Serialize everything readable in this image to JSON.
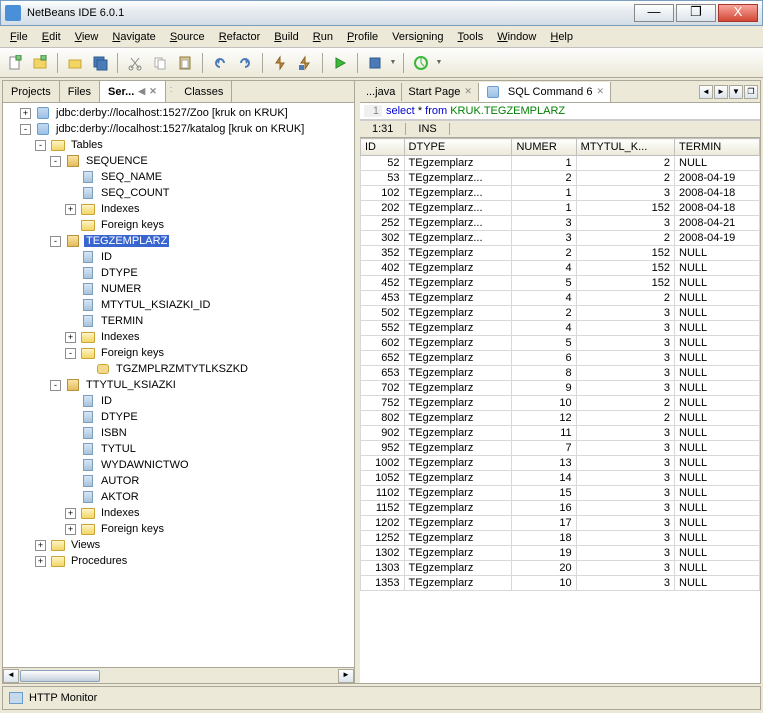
{
  "window": {
    "title": "NetBeans IDE 6.0.1"
  },
  "menu": [
    "File",
    "Edit",
    "View",
    "Navigate",
    "Source",
    "Refactor",
    "Build",
    "Run",
    "Profile",
    "Versioning",
    "Tools",
    "Window",
    "Help"
  ],
  "left_tabs": [
    {
      "label": "Projects",
      "active": false
    },
    {
      "label": "Files",
      "active": false
    },
    {
      "label": "Ser...",
      "active": true
    },
    {
      "label": "Classes",
      "active": false
    }
  ],
  "tree": {
    "conn1": "jdbc:derby://localhost:1527/Zoo [kruk on KRUK]",
    "conn2": "jdbc:derby://localhost:1527/katalog [kruk on KRUK]",
    "tables": "Tables",
    "sequence": {
      "name": "SEQUENCE",
      "cols": [
        "SEQ_NAME",
        "SEQ_COUNT"
      ],
      "indexes": "Indexes",
      "fk": "Foreign keys"
    },
    "tegz": {
      "name": "TEGZEMPLARZ",
      "cols": [
        "ID",
        "DTYPE",
        "NUMER",
        "MTYTUL_KSIAZKI_ID",
        "TERMIN"
      ],
      "indexes": "Indexes",
      "fk": "Foreign keys",
      "fk1": "TGZMPLRZMTYTLKSZKD"
    },
    "ttytul": {
      "name": "TTYTUL_KSIAZKI",
      "cols": [
        "ID",
        "DTYPE",
        "ISBN",
        "TYTUL",
        "WYDAWNICTWO",
        "AUTOR",
        "AKTOR"
      ],
      "indexes": "Indexes",
      "fk": "Foreign keys"
    },
    "views": "Views",
    "procedures": "Procedures"
  },
  "editor_tabs": [
    {
      "label": "...java",
      "active": false
    },
    {
      "label": "Start Page",
      "active": false
    },
    {
      "label": "SQL Command 6",
      "active": true
    }
  ],
  "sql": {
    "line": "1",
    "select": "select",
    "star": "*",
    "from": "from",
    "schema": "KRUK.TEGZEMPLARZ"
  },
  "status": {
    "pos": "1:31",
    "mode": "INS"
  },
  "columns": [
    "ID",
    "DTYPE",
    "NUMER",
    "MTYTUL_K...",
    "TERMIN"
  ],
  "rows": [
    [
      52,
      "TEgzemplarz",
      1,
      2,
      "NULL"
    ],
    [
      53,
      "TEgzemplarz...",
      2,
      2,
      "2008-04-19"
    ],
    [
      102,
      "TEgzemplarz...",
      1,
      3,
      "2008-04-18"
    ],
    [
      202,
      "TEgzemplarz...",
      1,
      152,
      "2008-04-18"
    ],
    [
      252,
      "TEgzemplarz...",
      3,
      3,
      "2008-04-21"
    ],
    [
      302,
      "TEgzemplarz...",
      3,
      2,
      "2008-04-19"
    ],
    [
      352,
      "TEgzemplarz",
      2,
      152,
      "NULL"
    ],
    [
      402,
      "TEgzemplarz",
      4,
      152,
      "NULL"
    ],
    [
      452,
      "TEgzemplarz",
      5,
      152,
      "NULL"
    ],
    [
      453,
      "TEgzemplarz",
      4,
      2,
      "NULL"
    ],
    [
      502,
      "TEgzemplarz",
      2,
      3,
      "NULL"
    ],
    [
      552,
      "TEgzemplarz",
      4,
      3,
      "NULL"
    ],
    [
      602,
      "TEgzemplarz",
      5,
      3,
      "NULL"
    ],
    [
      652,
      "TEgzemplarz",
      6,
      3,
      "NULL"
    ],
    [
      653,
      "TEgzemplarz",
      8,
      3,
      "NULL"
    ],
    [
      702,
      "TEgzemplarz",
      9,
      3,
      "NULL"
    ],
    [
      752,
      "TEgzemplarz",
      10,
      2,
      "NULL"
    ],
    [
      802,
      "TEgzemplarz",
      12,
      2,
      "NULL"
    ],
    [
      902,
      "TEgzemplarz",
      11,
      3,
      "NULL"
    ],
    [
      952,
      "TEgzemplarz",
      7,
      3,
      "NULL"
    ],
    [
      1002,
      "TEgzemplarz",
      13,
      3,
      "NULL"
    ],
    [
      1052,
      "TEgzemplarz",
      14,
      3,
      "NULL"
    ],
    [
      1102,
      "TEgzemplarz",
      15,
      3,
      "NULL"
    ],
    [
      1152,
      "TEgzemplarz",
      16,
      3,
      "NULL"
    ],
    [
      1202,
      "TEgzemplarz",
      17,
      3,
      "NULL"
    ],
    [
      1252,
      "TEgzemplarz",
      18,
      3,
      "NULL"
    ],
    [
      1302,
      "TEgzemplarz",
      19,
      3,
      "NULL"
    ],
    [
      1303,
      "TEgzemplarz",
      20,
      3,
      "NULL"
    ],
    [
      1353,
      "TEgzemplarz",
      10,
      3,
      "NULL"
    ]
  ],
  "bottom": {
    "label": "HTTP Monitor"
  }
}
